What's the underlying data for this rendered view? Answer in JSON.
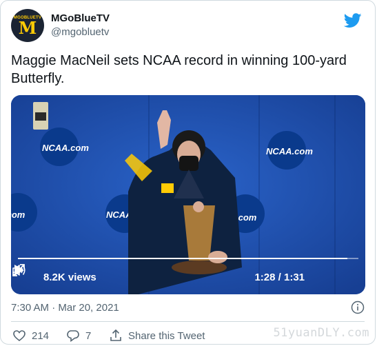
{
  "account": {
    "name": "MGoBlueTV",
    "handle": "@mgobluetv",
    "avatar_tag": "MGOBLUETV",
    "avatar_letter": "M"
  },
  "tweet": {
    "text": "Maggie MacNeil sets NCAA record in winning 100-yard Butterfly."
  },
  "video": {
    "views": "8.2K views",
    "time": "1:28 / 1:31",
    "progress": 0.967,
    "logo_text": "NCAA.com"
  },
  "meta": {
    "timestamp": "7:30 AM · Mar 20, 2021"
  },
  "actions": {
    "likes": "214",
    "replies": "7",
    "share_label": "Share this Tweet"
  },
  "watermark": "51yuanDLY.com",
  "colors": {
    "twitter_blue": "#1d9bf0",
    "michigan_maize": "#ffcb05",
    "backdrop_blue": "#1f4fb0"
  }
}
